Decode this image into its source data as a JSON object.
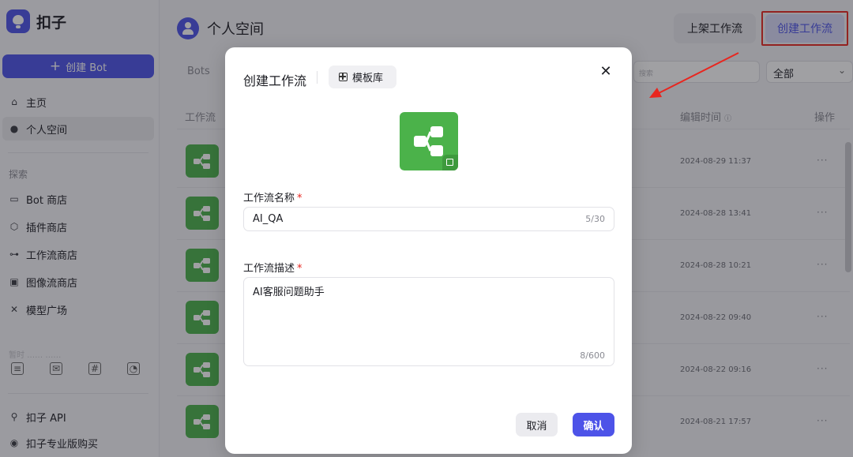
{
  "sidebar": {
    "logo_text": "扣子",
    "create_bot_label": "创建 Bot",
    "nav": [
      {
        "label": "主页",
        "icon": "home-icon"
      },
      {
        "label": "个人空间",
        "icon": "user-icon"
      }
    ],
    "explore_label": "探索",
    "explore_items": [
      {
        "label": "Bot 商店",
        "icon": "bot-icon"
      },
      {
        "label": "插件商店",
        "icon": "plugin-icon"
      },
      {
        "label": "工作流商店",
        "icon": "workflow-icon"
      },
      {
        "label": "图像流商店",
        "icon": "image-icon"
      },
      {
        "label": "模型广场",
        "icon": "model-icon"
      }
    ],
    "faded_text": "暂时 …… ……",
    "bottom_items": [
      {
        "label": "扣子 API",
        "icon": "api-icon"
      },
      {
        "label": "扣子专业版购买",
        "icon": "pro-icon"
      }
    ]
  },
  "header": {
    "space_name": "个人空间",
    "publish_button": "上架工作流",
    "create_button": "创建工作流"
  },
  "toolbar": {
    "tab_bots": "Bots",
    "search_placeholder": "搜索",
    "filter_value": "全部"
  },
  "table": {
    "columns": [
      "工作流",
      "编辑时间",
      "操作"
    ],
    "edit_time_info_icon": "info-icon",
    "rows": [
      {
        "time": "2024-08-29 11:37",
        "more": "···"
      },
      {
        "time": "2024-08-28 13:41",
        "more": "···"
      },
      {
        "time": "2024-08-28 10:21",
        "more": "···"
      },
      {
        "time": "2024-08-22 09:40",
        "more": "···"
      },
      {
        "time": "2024-08-22 09:16",
        "more": "···"
      },
      {
        "time": "2024-08-21 17:57",
        "more": "···"
      }
    ]
  },
  "modal": {
    "title": "创建工作流",
    "template_button": "模板库",
    "name_label": "工作流名称",
    "name_value": "AI_QA",
    "name_counter": "5/30",
    "desc_label": "工作流描述",
    "desc_value": "AI客服问题助手",
    "desc_counter": "8/600",
    "required_mark": "*",
    "cancel_label": "取消",
    "confirm_label": "确认",
    "close_icon": "✕"
  },
  "colors": {
    "brand": "#4d53e8",
    "workflow_green": "#4bb24a",
    "annotation_red": "#e8261f"
  }
}
